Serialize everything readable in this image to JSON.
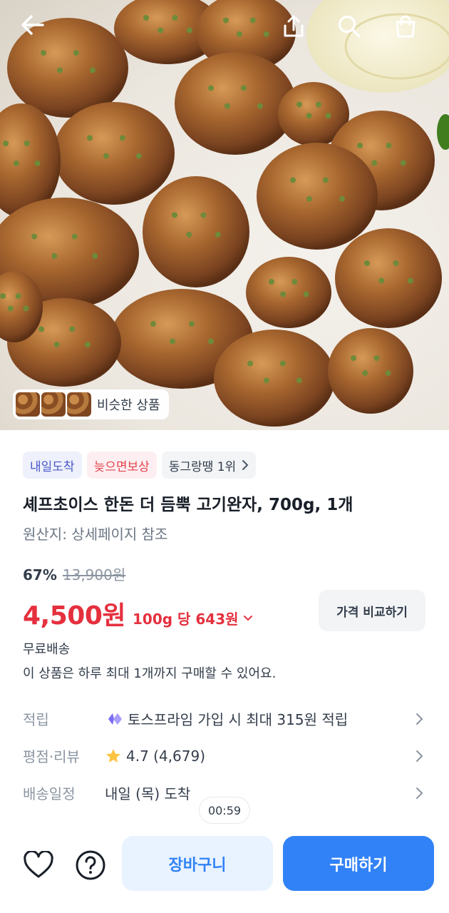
{
  "hero": {
    "similar_label": "비슷한 상품",
    "icons": [
      "back-arrow-icon",
      "share-icon",
      "search-icon",
      "shopping-bag-icon"
    ]
  },
  "chips": [
    {
      "label": "내일도착",
      "color": "#4957c9"
    },
    {
      "label": "늦으면보상",
      "color": "#e5424d"
    },
    {
      "label": "동그랑땡 1위"
    }
  ],
  "product": {
    "title": "셰프초이스 한돈 더 듬뿍 고기완자, 700g, 1개",
    "origin": "원산지: 상세페이지 참조",
    "discount": "67%",
    "original_price": "13,900원",
    "price": "4,500원",
    "unit_price": "100g 당 643원",
    "compare_label": "가격 비교하기",
    "shipping": "무료배송",
    "limit_notice": "이 상품은 하루 최대 1개까지 구매할 수 있어요."
  },
  "info": [
    {
      "label": "적립",
      "value": "토스프라임 가입 시 최대 315원 적립",
      "icon": "toss-prime-icon"
    },
    {
      "label": "평점·리뷰",
      "value": "4.7 (4,679)",
      "icon": "star-icon"
    },
    {
      "label": "배송일정",
      "value": "내일 (목) 도착"
    }
  ],
  "timer": "00:59",
  "bottom": {
    "cart_label": "장바구니",
    "buy_label": "구매하기",
    "icons": [
      "heart-icon",
      "question-icon"
    ]
  },
  "colors": {
    "accent_blue": "#3182f6",
    "price_red": "#e5303e"
  }
}
